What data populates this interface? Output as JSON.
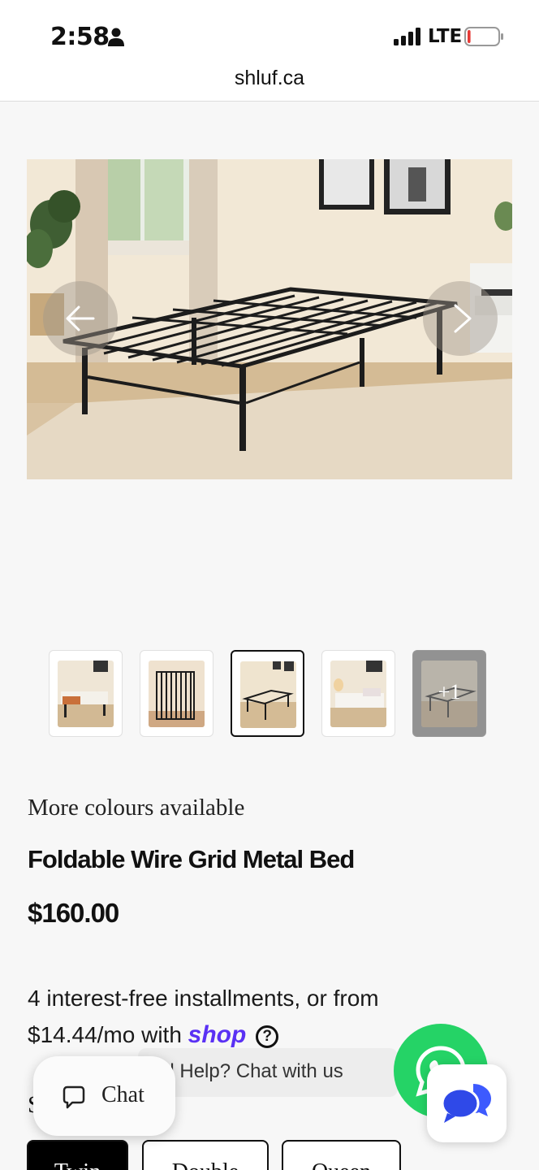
{
  "status_bar": {
    "time": "2:58",
    "network": "LTE",
    "battery_level_fraction": 0.1,
    "battery_color": "#e53935"
  },
  "browser": {
    "url": "shluf.ca"
  },
  "gallery": {
    "thumbnails": [
      {
        "name": "bed-with-bedding"
      },
      {
        "name": "folded-frame"
      },
      {
        "name": "frame-in-room"
      },
      {
        "name": "white-bedding"
      },
      {
        "name": "more",
        "more_label": "+1"
      }
    ],
    "active_index": 2
  },
  "product": {
    "colours_note": "More colours available",
    "title": "Foldable Wire Grid Metal Bed",
    "price": "$160.00",
    "installments_line1": "4 interest-free installments, or from",
    "installments_amount": "$14.44",
    "installments_suffix": "/mo with",
    "shop_brand": "shop",
    "shop_brand_color": "#5a31f4"
  },
  "chat_widget": {
    "need_help_text": "ed Help? Chat with us",
    "chat_label": "Chat",
    "whatsapp_color": "#25d366"
  },
  "size_selector": {
    "label_partial": "S",
    "options": [
      "Twin",
      "Double",
      "Queen"
    ],
    "selected": "Twin"
  }
}
